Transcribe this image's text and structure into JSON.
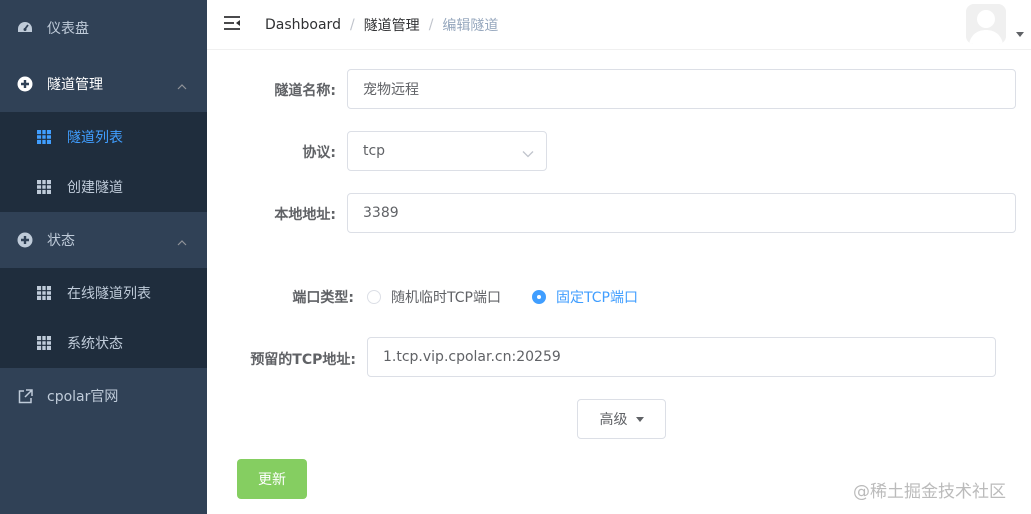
{
  "sidebar": {
    "items": [
      {
        "label": "仪表盘",
        "icon": "dashboard-icon"
      },
      {
        "label": "隧道管理",
        "icon": "tunnel-icon",
        "expanded": true
      },
      {
        "label": "隧道列表",
        "icon": "grid-icon",
        "active": true
      },
      {
        "label": "创建隧道",
        "icon": "grid-icon"
      },
      {
        "label": "状态",
        "icon": "status-icon",
        "expanded": true
      },
      {
        "label": "在线隧道列表",
        "icon": "grid-icon"
      },
      {
        "label": "系统状态",
        "icon": "grid-icon"
      },
      {
        "label": "cpolar官网",
        "icon": "external-link-icon"
      }
    ]
  },
  "navbar": {
    "breadcrumb": [
      "Dashboard",
      "隧道管理",
      "编辑隧道"
    ]
  },
  "form": {
    "name_label": "隧道名称:",
    "name_value": "宠物远程",
    "protocol_label": "协议:",
    "protocol_value": "tcp",
    "local_label": "本地地址:",
    "local_value": "3389",
    "port_type_label": "端口类型:",
    "port_options": [
      "随机临时TCP端口",
      "固定TCP端口"
    ],
    "port_selected": "固定TCP端口",
    "reserved_label": "预留的TCP地址:",
    "reserved_value": "1.tcp.vip.cpolar.cn:20259",
    "advanced_label": "高级",
    "update_label": "更新"
  },
  "watermark": "@稀土掘金技术社区",
  "colors": {
    "sidebar_bg": "#304156",
    "submenu_bg": "#1f2d3d",
    "accent": "#409eff",
    "success": "#85ce61"
  }
}
